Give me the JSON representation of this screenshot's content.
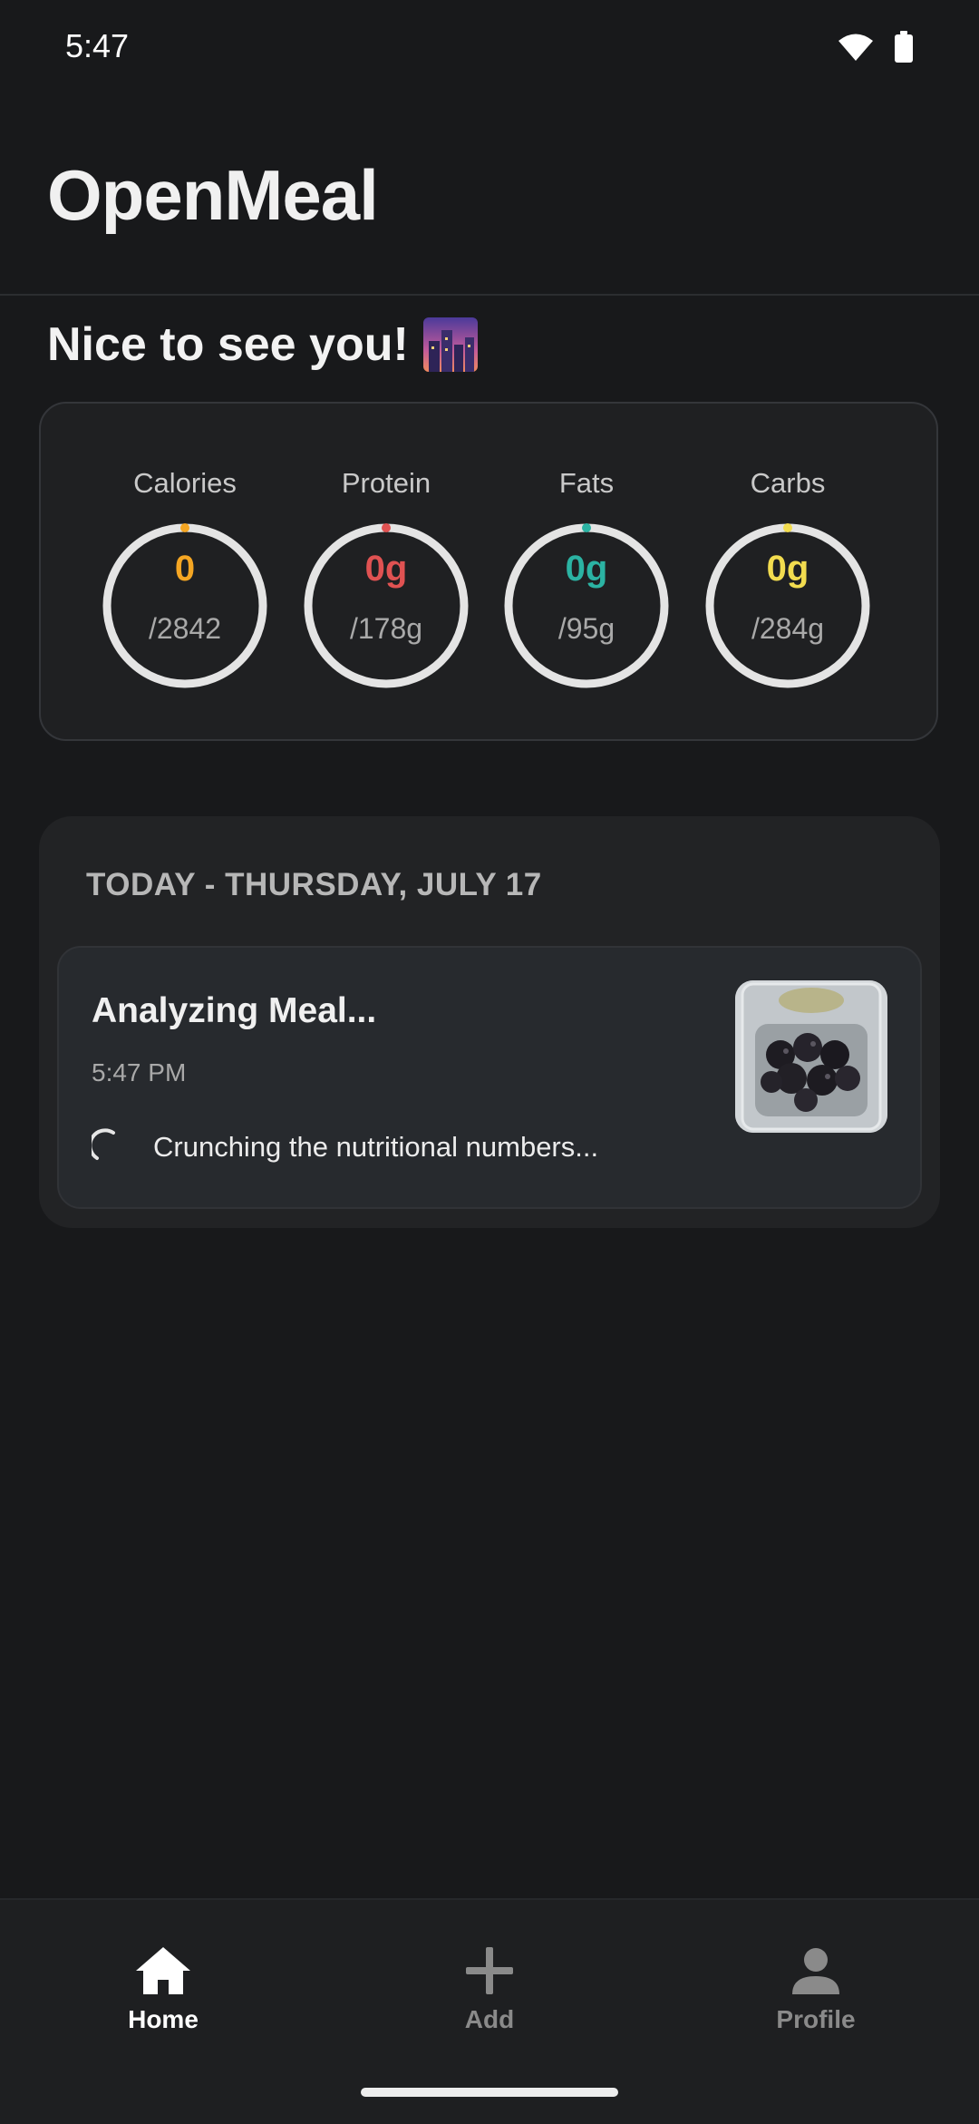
{
  "status_bar": {
    "time": "5:47"
  },
  "header": {
    "title": "OpenMeal"
  },
  "greeting": {
    "text": "Nice to see you!"
  },
  "macros": [
    {
      "label": "Calories",
      "value": "0",
      "goal": "/2842",
      "color": "#f5a623"
    },
    {
      "label": "Protein",
      "value": "0g",
      "goal": "/178g",
      "color": "#e05252"
    },
    {
      "label": "Fats",
      "value": "0g",
      "goal": "/95g",
      "color": "#2bb3a3"
    },
    {
      "label": "Carbs",
      "value": "0g",
      "goal": "/284g",
      "color": "#f2dc4f"
    }
  ],
  "today": {
    "header": "TODAY - THURSDAY, JULY 17",
    "meal": {
      "title": "Analyzing Meal...",
      "time": "5:47 PM",
      "status": "Crunching the nutritional numbers..."
    }
  },
  "nav": {
    "home": "Home",
    "add": "Add",
    "profile": "Profile"
  },
  "icons": {
    "status": [
      "wifi-icon",
      "battery-icon"
    ],
    "greeting": "city-sunset-icon",
    "nav": [
      "home-icon",
      "plus-icon",
      "person-icon"
    ]
  }
}
